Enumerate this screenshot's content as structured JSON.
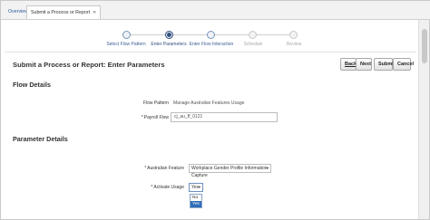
{
  "tabs": {
    "overview": "Overview",
    "active": "Submit a Process or Report"
  },
  "train": {
    "stops": [
      {
        "label": "Select Flow Pattern",
        "state": "done"
      },
      {
        "label": "Enter Parameters",
        "state": "current"
      },
      {
        "label": "Enter Flow Interaction",
        "state": "done"
      },
      {
        "label": "Schedule",
        "state": "future"
      },
      {
        "label": "Review",
        "state": "future"
      }
    ]
  },
  "page": {
    "title": "Submit a Process or Report: Enter Parameters"
  },
  "buttons": {
    "back": "Back",
    "next": "Next",
    "submit": "Submit",
    "cancel": "Cancel"
  },
  "flow_details": {
    "heading": "Flow Details",
    "pattern_label": "Flow Pattern",
    "pattern_value": "Manage Australian Features Usage",
    "payroll_flow_label": "Payroll Flow",
    "payroll_flow_value": "cj_au_ff_0121",
    "required_marker": "*"
  },
  "parameter_details": {
    "heading": "Parameter Details",
    "feature_label": "Australian Feature",
    "feature_value": "Workplace Gender Profile Information Capture",
    "activate_label": "Activate Usage",
    "activate_value": "Yes",
    "options": [
      "No",
      "Yes"
    ],
    "selected_option": "Yes"
  },
  "colors": {
    "accent": "#2f4f7f",
    "link": "#3b5f96",
    "selected_option_bg": "#2f6db8"
  }
}
